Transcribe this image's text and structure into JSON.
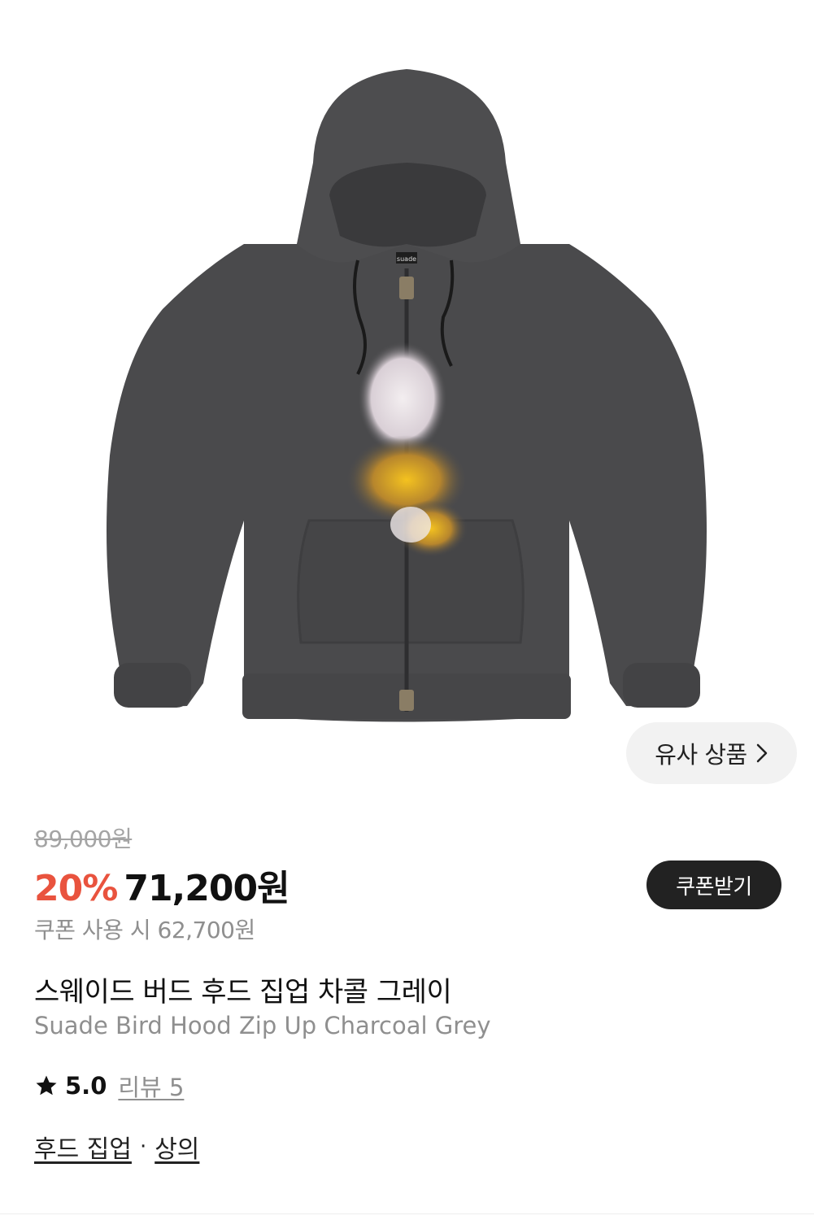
{
  "product": {
    "image_alt": "Charcoal grey zip-up hoodie with bird graphic",
    "hoodie_tag": "suade",
    "similar_button_label": "유사 상품",
    "original_price": "89,000원",
    "discount_rate": "20%",
    "sale_price": "71,200원",
    "coupon_button_label": "쿠폰받기",
    "coupon_price_text": "쿠폰 사용 시 62,700원",
    "name_ko": "스웨이드 버드 후드 집업 차콜 그레이",
    "name_en": "Suade Bird Hood Zip Up Charcoal Grey",
    "rating": "5.0",
    "review_link": "리뷰 5",
    "categories": [
      "후드 집업",
      "상의"
    ],
    "category_separator": "·"
  },
  "colors": {
    "discount": "#e9533e",
    "coupon_button_bg": "#222222",
    "hoodie": "#4a4a4c",
    "muted_text": "#8f8f8f"
  },
  "icons": {
    "similar_chevron": "chevron-right-icon",
    "rating_star": "star-icon"
  }
}
